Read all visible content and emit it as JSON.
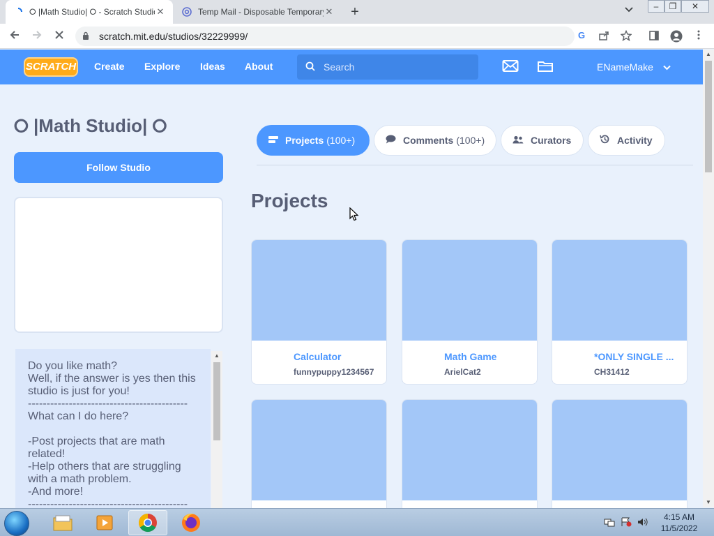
{
  "browser": {
    "tabs": [
      {
        "title": "⭘ |Math Studio| ⭘ - Scratch Studio",
        "active": true
      },
      {
        "title": "Temp Mail - Disposable Temporary Email",
        "active": false
      }
    ],
    "url": "scratch.mit.edu/studios/32229999/",
    "new_tab": "+",
    "close_glyph": "✕"
  },
  "nav": {
    "logo": "SCRATCH",
    "links": [
      "Create",
      "Explore",
      "Ideas",
      "About"
    ],
    "search_placeholder": "Search",
    "username": "ENameMake"
  },
  "studio": {
    "title": "⭘ |Math Studio| ⭘",
    "follow_label": "Follow Studio",
    "description": "Do you like math?\nWell, if the answer is yes then this studio is just for you!\n-------------------------------------------\nWhat can I do here?\n\n-Post projects that are math related!\n-Help others that are struggling with a math problem.\n-And more!\n-------------------------------------------"
  },
  "tabs": [
    {
      "label": "Projects",
      "count": "(100+)",
      "icon": "projects-icon",
      "active": true
    },
    {
      "label": "Comments",
      "count": "(100+)",
      "icon": "comment-icon",
      "active": false
    },
    {
      "label": "Curators",
      "count": "",
      "icon": "curators-icon",
      "active": false
    },
    {
      "label": "Activity",
      "count": "",
      "icon": "activity-icon",
      "active": false
    }
  ],
  "projects_heading": "Projects",
  "projects": [
    {
      "title": "Calculator",
      "author": "funnypuppy1234567"
    },
    {
      "title": "Math Game",
      "author": "ArielCat2"
    },
    {
      "title": "*ONLY SINGLE ...",
      "author": "CH31412"
    },
    {
      "title": "",
      "author": ""
    },
    {
      "title": "",
      "author": ""
    },
    {
      "title": "",
      "author": ""
    }
  ],
  "taskbar": {
    "time": "4:15 AM",
    "date": "11/5/2022"
  },
  "colors": {
    "scratch_blue": "#4c97ff",
    "thumb_blue": "#a3c7f8",
    "text_gray": "#575e75"
  }
}
